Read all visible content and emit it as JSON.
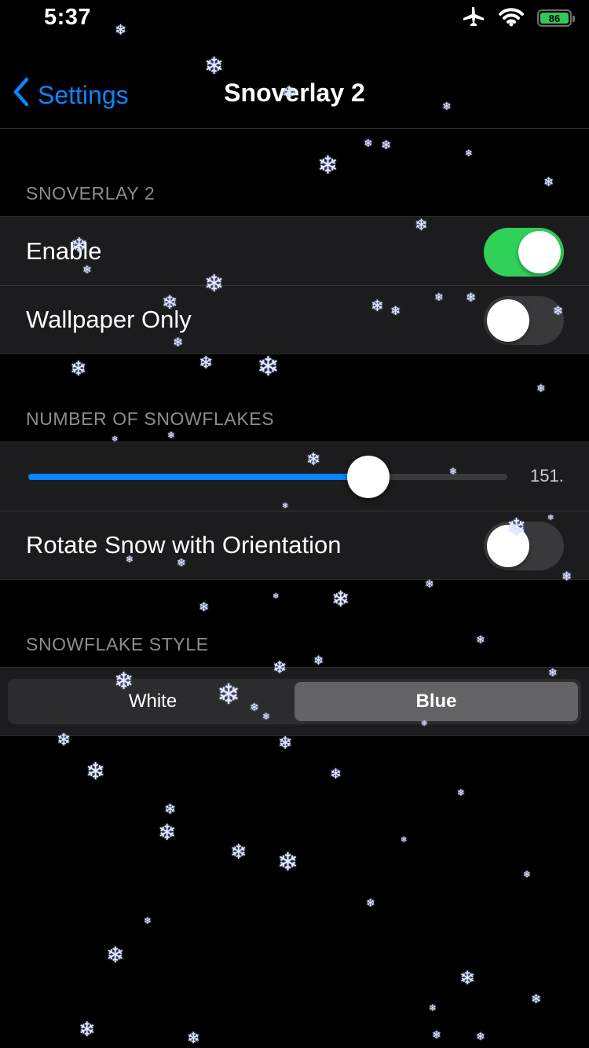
{
  "status_bar": {
    "time": "5:37",
    "battery": "86",
    "icons": [
      "airplane-icon",
      "wifi-icon",
      "battery-icon"
    ]
  },
  "nav": {
    "back_label": "Settings",
    "title": "Snoverlay 2"
  },
  "sections": {
    "main": {
      "header": "SNOVERLAY 2",
      "rows": [
        {
          "label": "Enable",
          "on": true
        },
        {
          "label": "Wallpaper Only",
          "on": false
        }
      ]
    },
    "snowflakes": {
      "header": "NUMBER OF SNOWFLAKES",
      "slider_value_text": "151.",
      "slider_fraction": 0.71,
      "rotate_label": "Rotate Snow with Orientation",
      "rotate_on": false
    },
    "style": {
      "header": "SNOWFLAKE STYLE",
      "options": [
        "White",
        "Blue"
      ],
      "selected": "Blue"
    }
  },
  "colors": {
    "accent": "#0a84ff",
    "switch_on": "#30d158",
    "background": "#000000",
    "group_background": "#1c1c1e",
    "snowflake": "#e8ecff"
  }
}
